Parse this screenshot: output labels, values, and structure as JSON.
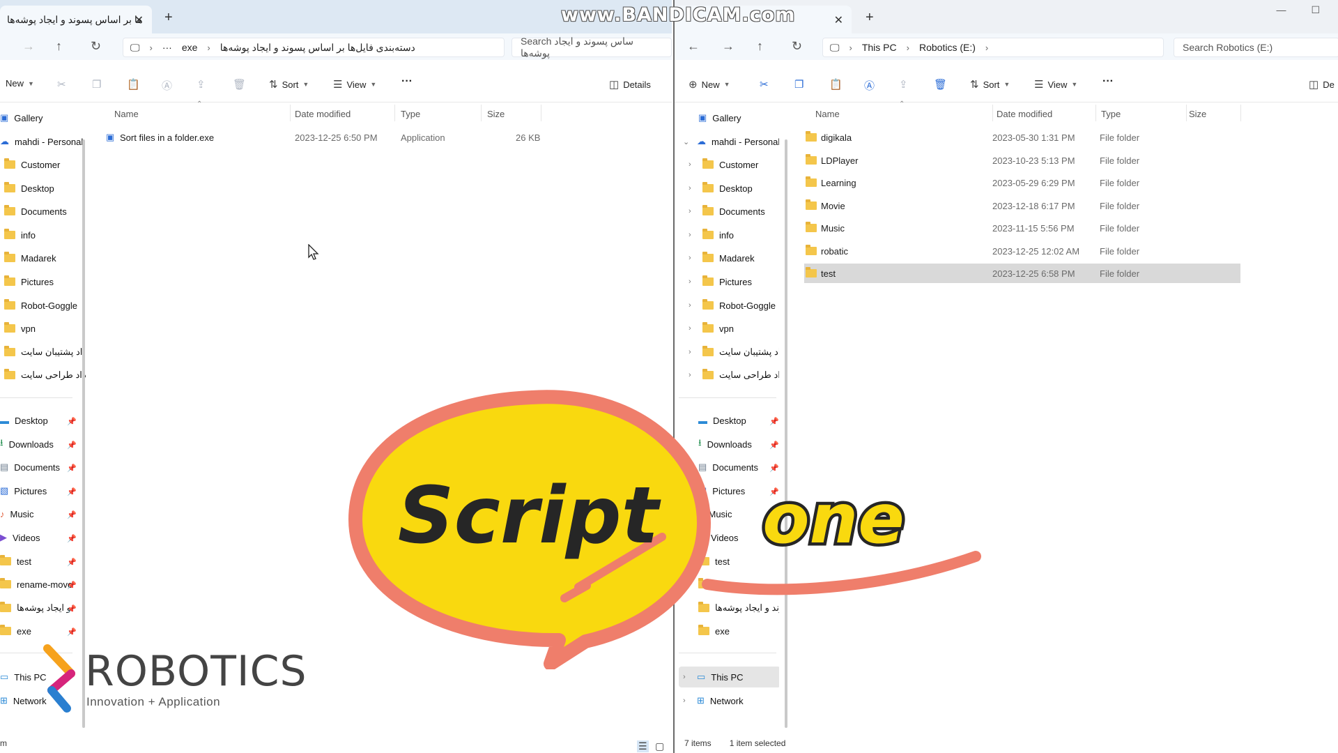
{
  "watermark": "www.BANDICAM.com",
  "left": {
    "tab_title": "ها بر اساس پسوند و ایجاد پوشه‌ها",
    "breadcrumb": [
      "exe",
      "دسته‌بندی فایل‌ها بر اساس پسوند و ایجاد پوشه‌ها"
    ],
    "search_placeholder": "Search ساس پسوند و ایجاد پوشه‌ها",
    "toolbar": {
      "new": "New",
      "sort": "Sort",
      "view": "View",
      "details": "Details"
    },
    "nav_top": [
      "Gallery",
      "mahdi - Personal",
      "Customer",
      "Desktop",
      "Documents",
      "info",
      "Madarek",
      "Pictures",
      "Robot-Goggle",
      "vpn",
      "اد پشتیبان سایت",
      "داد طراحی سایت"
    ],
    "nav_quick": [
      "Desktop",
      "Downloads",
      "Documents",
      "Pictures",
      "Music",
      "Videos",
      "test",
      "rename-move",
      "و ایجاد پوشه‌ها",
      "exe"
    ],
    "nav_bottom": [
      "This PC",
      "Network"
    ],
    "columns": [
      "Name",
      "Date modified",
      "Type",
      "Size"
    ],
    "files": [
      {
        "name": "Sort files in a folder.exe",
        "date": "2023-12-25 6:50 PM",
        "type": "Application",
        "size": "26 KB"
      }
    ],
    "status_fragment": "m"
  },
  "right": {
    "breadcrumb": [
      "This PC",
      "Robotics (E:)"
    ],
    "search_placeholder": "Search Robotics (E:)",
    "toolbar": {
      "new": "New",
      "sort": "Sort",
      "view": "View",
      "details": "De"
    },
    "nav_top": [
      "Gallery",
      "mahdi - Personal",
      "Customer",
      "Desktop",
      "Documents",
      "info",
      "Madarek",
      "Pictures",
      "Robot-Goggle",
      "vpn",
      "اد پشتیبان سایت",
      "داد طراحی سایت"
    ],
    "nav_quick": [
      "Desktop",
      "Downloads",
      "Documents",
      "Pictures",
      "Music",
      "Videos",
      "test",
      "",
      "وند و ایجاد پوشه‌ها",
      "exe"
    ],
    "nav_bottom": [
      "This PC",
      "Network"
    ],
    "columns": [
      "Name",
      "Date modified",
      "Type",
      "Size"
    ],
    "files": [
      {
        "name": "digikala",
        "date": "2023-05-30 1:31 PM",
        "type": "File folder"
      },
      {
        "name": "LDPlayer",
        "date": "2023-10-23 5:13 PM",
        "type": "File folder"
      },
      {
        "name": "Learning",
        "date": "2023-05-29 6:29 PM",
        "type": "File folder"
      },
      {
        "name": "Movie",
        "date": "2023-12-18 6:17 PM",
        "type": "File folder"
      },
      {
        "name": "Music",
        "date": "2023-11-15 5:56 PM",
        "type": "File folder"
      },
      {
        "name": "robatic",
        "date": "2023-12-25 12:02 AM",
        "type": "File folder"
      },
      {
        "name": "test",
        "date": "2023-12-25 6:58 PM",
        "type": "File folder"
      }
    ],
    "status": {
      "items": "7 items",
      "selected": "1 item selected"
    }
  },
  "sticker": {
    "bubble_text": "Script",
    "extra_text": "one",
    "bubble_color": "#f9d90f",
    "ring_color": "#ef7e6b"
  },
  "logo": {
    "name": "ROBOTICS",
    "tagline": "Innovation + Application"
  }
}
